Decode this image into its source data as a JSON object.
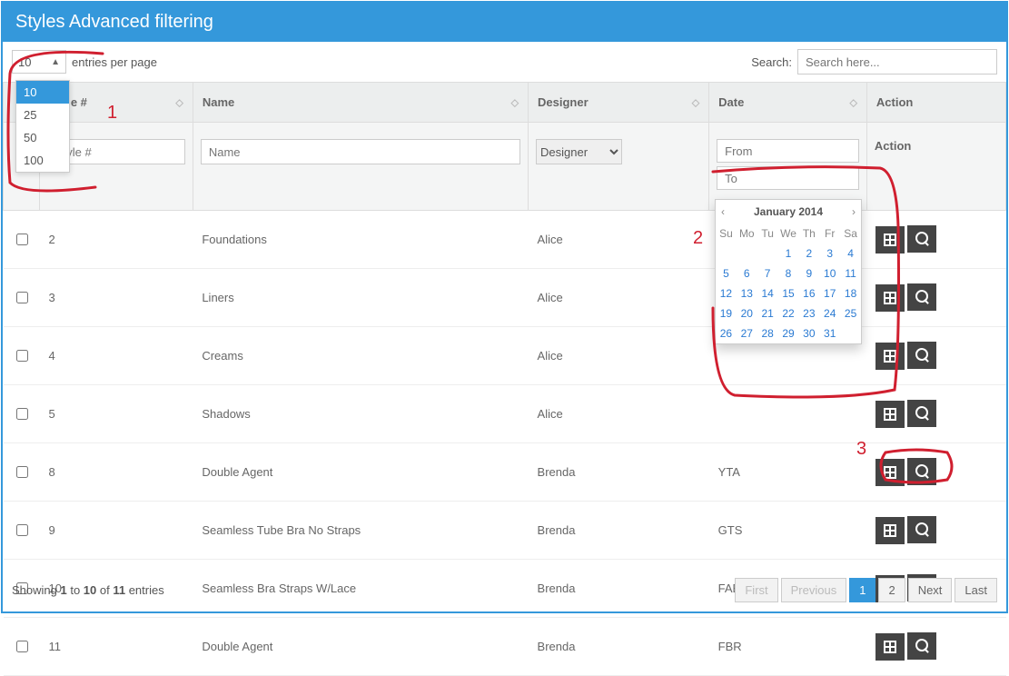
{
  "header": {
    "title": "Styles Advanced filtering"
  },
  "controls": {
    "entries_label": "entries per page",
    "page_size_value": "10",
    "page_size_options": [
      "10",
      "25",
      "50",
      "100"
    ],
    "search_label": "Search:",
    "search_placeholder": "Search here..."
  },
  "columns": {
    "check": "",
    "style_no": "Style #",
    "name": "Name",
    "designer": "Designer",
    "date": "Date",
    "action": "Action"
  },
  "filters": {
    "style_no_placeholder": "Style #",
    "name_placeholder": "Name",
    "designer_selected": "Designer",
    "date_from_placeholder": "From",
    "date_to_placeholder": "To",
    "action_label": "Action"
  },
  "rows": [
    {
      "num": "2",
      "name": "Foundations",
      "designer": "Alice",
      "date": ""
    },
    {
      "num": "3",
      "name": "Liners",
      "designer": "Alice",
      "date": ""
    },
    {
      "num": "4",
      "name": "Creams",
      "designer": "Alice",
      "date": ""
    },
    {
      "num": "5",
      "name": "Shadows",
      "designer": "Alice",
      "date": ""
    },
    {
      "num": "8",
      "name": "Double Agent",
      "designer": "Brenda",
      "date": "YTA"
    },
    {
      "num": "9",
      "name": "Seamless Tube Bra No Straps",
      "designer": "Brenda",
      "date": "GTS"
    },
    {
      "num": "10",
      "name": "Seamless Bra Straps W/Lace",
      "designer": "Brenda",
      "date": "FAB"
    },
    {
      "num": "11",
      "name": "Double Agent",
      "designer": "Brenda",
      "date": "FBR"
    }
  ],
  "calendar": {
    "title": "January 2014",
    "dow": [
      "Su",
      "Mo",
      "Tu",
      "We",
      "Th",
      "Fr",
      "Sa"
    ],
    "lead_blanks": 3,
    "days": 31
  },
  "annotations": {
    "a1": "1",
    "a2": "2",
    "a3": "3"
  },
  "footer": {
    "info_pre": "Showing ",
    "info_b1": "1",
    "info_mid1": " to ",
    "info_b2": "10",
    "info_mid2": " of ",
    "info_b3": "11",
    "info_post": " entries",
    "first": "First",
    "prev": "Previous",
    "p1": "1",
    "p2": "2",
    "next": "Next",
    "last": "Last"
  }
}
